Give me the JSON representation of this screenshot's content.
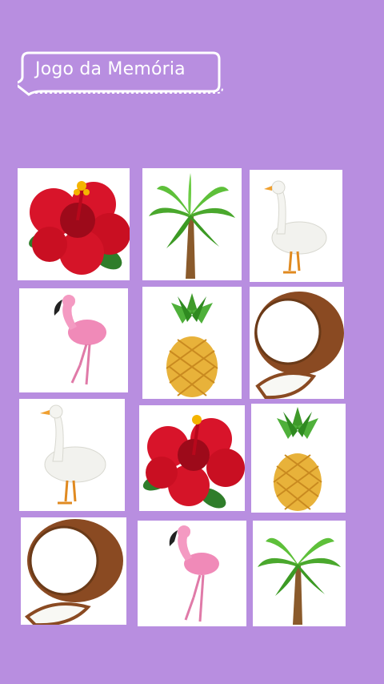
{
  "header": {
    "title": "Jogo da Memória"
  },
  "board": {
    "cards": [
      {
        "item": "hibiscus-flower"
      },
      {
        "item": "palm-tree"
      },
      {
        "item": "goose"
      },
      {
        "item": "flamingo"
      },
      {
        "item": "pineapple"
      },
      {
        "item": "coconut"
      },
      {
        "item": "goose"
      },
      {
        "item": "hibiscus-flower"
      },
      {
        "item": "pineapple"
      },
      {
        "item": "coconut"
      },
      {
        "item": "flamingo"
      },
      {
        "item": "palm-tree"
      }
    ]
  },
  "colors": {
    "background": "#b88ee0",
    "card": "#ffffff",
    "badge_border": "#ffffff"
  }
}
